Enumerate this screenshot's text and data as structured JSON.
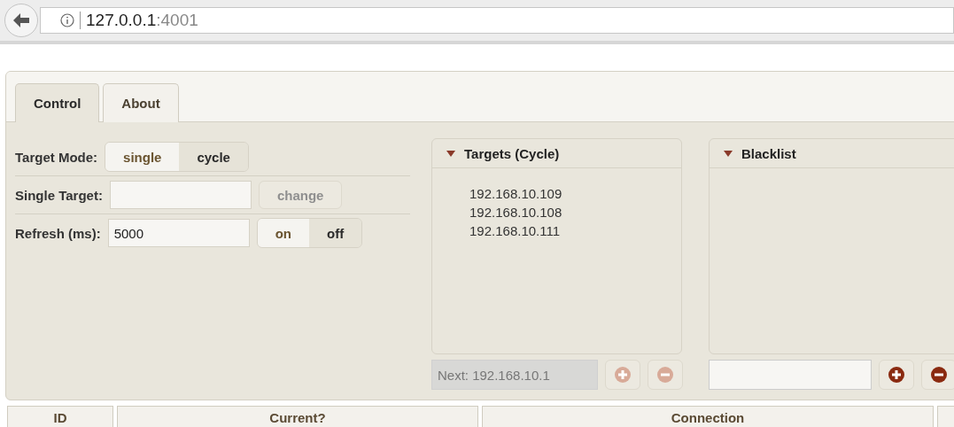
{
  "browser": {
    "address": {
      "host": "127.0.0.1",
      "port": ":4001"
    }
  },
  "tabs": [
    {
      "label": "Control",
      "selected": true
    },
    {
      "label": "About",
      "selected": false
    }
  ],
  "control": {
    "target_mode": {
      "label": "Target Mode:",
      "options": [
        {
          "label": "single",
          "selected": true
        },
        {
          "label": "cycle",
          "selected": false
        }
      ]
    },
    "single_target": {
      "label": "Single Target:",
      "button": {
        "label": "change",
        "disabled": true
      }
    },
    "refresh": {
      "label": "Refresh (ms):",
      "value": "5000",
      "options": [
        {
          "label": "on",
          "selected": true
        },
        {
          "label": "off",
          "selected": false
        }
      ]
    }
  },
  "targets": {
    "title": "Targets (Cycle)",
    "expanded": true,
    "items": [
      "192.168.10.109",
      "192.168.10.108",
      "192.168.10.111"
    ],
    "next": "Next: 192.168.10.1",
    "disabled": true
  },
  "blacklist": {
    "title": "Blacklist",
    "expanded": true,
    "disabled": false
  },
  "table": {
    "columns": [
      "ID",
      "Current?",
      "Connection"
    ]
  }
}
